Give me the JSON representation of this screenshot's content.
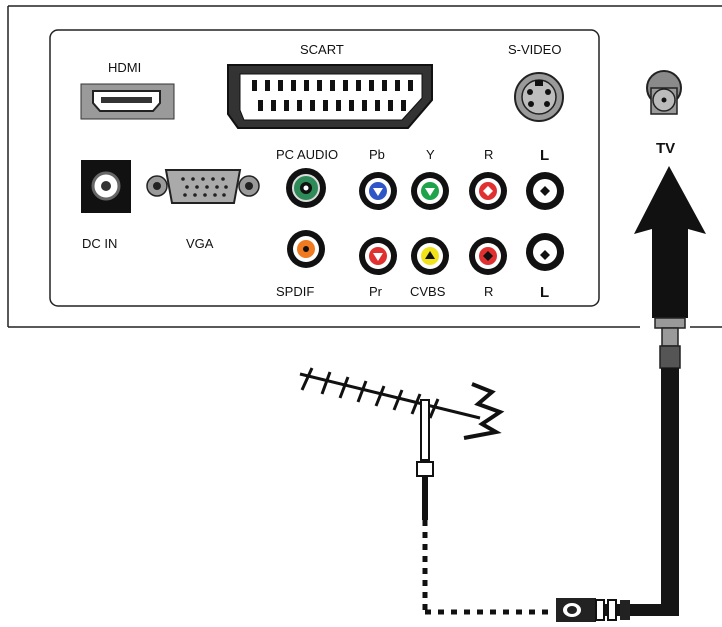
{
  "labels": {
    "hdmi": "HDMI",
    "scart": "SCART",
    "svideo": "S-VIDEO",
    "tv": "TV",
    "dc_in": "DC IN",
    "vga": "VGA",
    "pc_audio": "PC AUDIO",
    "pb": "Pb",
    "y": "Y",
    "r_top": "R",
    "l_top": "L",
    "spdif": "SPDIF",
    "pr": "Pr",
    "cvbs": "CVBS",
    "r_bottom": "R",
    "l_bottom": "L"
  },
  "colors": {
    "pc_audio_jack": "#2e8b57",
    "pb_jack": "#2f56c6",
    "y_jack": "#1fa34a",
    "r_jack": "#e03030",
    "l_jack": "#ffffff",
    "spdif_jack": "#f07a20",
    "pr_jack": "#e03030",
    "cvbs_jack": "#f2e21a",
    "panel_line": "#222222",
    "cable": "#151515"
  },
  "icons": [
    "hdmi-port-icon",
    "scart-port-icon",
    "svideo-port-icon",
    "tv-coax-port-icon",
    "dc-in-port-icon",
    "vga-port-icon",
    "rca-jack-icon",
    "antenna-icon",
    "arrow-up-icon",
    "coax-plug-icon"
  ]
}
